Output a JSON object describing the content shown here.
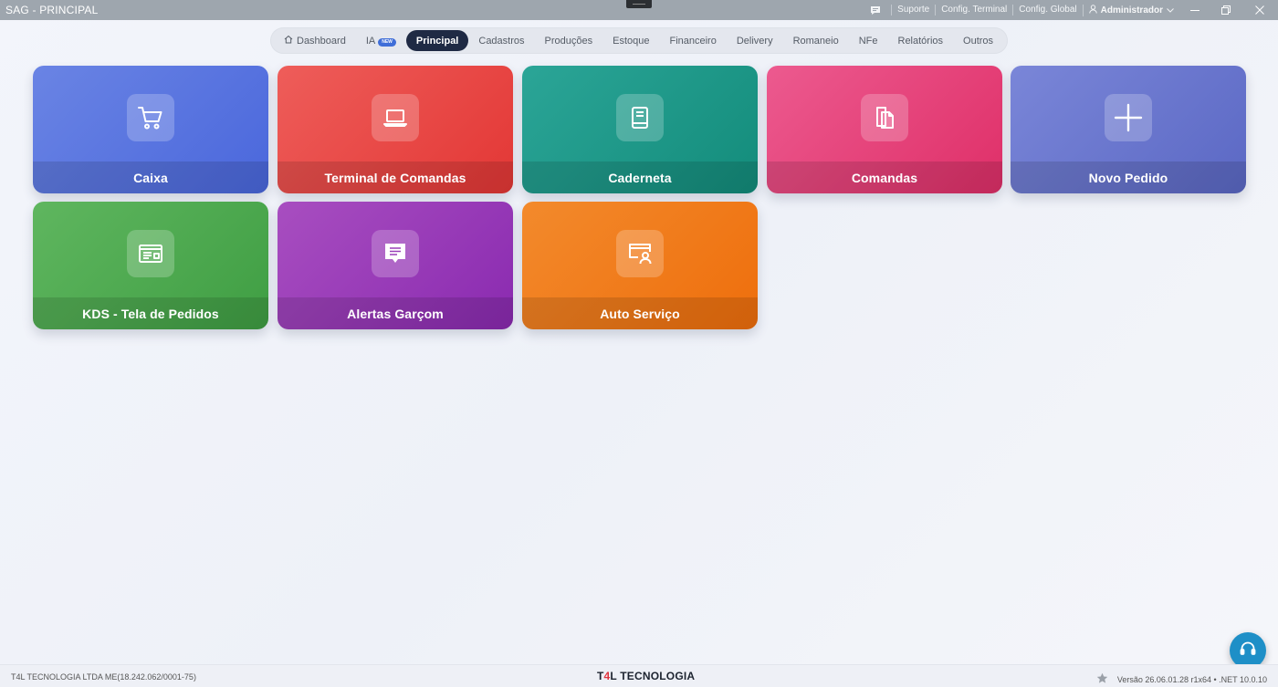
{
  "window": {
    "title": "SAG - PRINCIPAL",
    "links": [
      "Suporte",
      "Config. Terminal",
      "Config. Global"
    ],
    "user": "Administrador"
  },
  "nav": {
    "items": [
      {
        "label": "Dashboard"
      },
      {
        "label": "IA",
        "badge": "NEW"
      },
      {
        "label": "Principal",
        "active": true
      },
      {
        "label": "Cadastros"
      },
      {
        "label": "Produções"
      },
      {
        "label": "Estoque"
      },
      {
        "label": "Financeiro"
      },
      {
        "label": "Delivery"
      },
      {
        "label": "Romaneio"
      },
      {
        "label": "NFe"
      },
      {
        "label": "Relatórios"
      },
      {
        "label": "Outros"
      }
    ]
  },
  "tiles": [
    {
      "label": "Caixa",
      "icon": "cart-icon",
      "color": "#4a67dc"
    },
    {
      "label": "Terminal de Comandas",
      "icon": "laptop-icon",
      "color": "#e33735"
    },
    {
      "label": "Caderneta",
      "icon": "notebook-icon",
      "color": "#138c7b"
    },
    {
      "label": "Comandas",
      "icon": "documents-icon",
      "color": "#df2f68"
    },
    {
      "label": "Novo Pedido",
      "icon": "plus-icon",
      "color": "#5b68c4"
    },
    {
      "label": "KDS - Tela de Pedidos",
      "icon": "display-icon",
      "color": "#3f9e43"
    },
    {
      "label": "Alertas Garçom",
      "icon": "message-icon",
      "color": "#8a2ab0"
    },
    {
      "label": "Auto Serviço",
      "icon": "kiosk-user-icon",
      "color": "#ee6e0c"
    }
  ],
  "footer": {
    "company": "T4L TECNOLOGIA LTDA ME(18.242.062/0001-75)",
    "brand_prefix": "T",
    "brand_accent": "4",
    "brand_rest": "L TECNOLOGIA",
    "version": "Versão 26.06.01.28 r1x64  •  .NET 10.0.10"
  }
}
